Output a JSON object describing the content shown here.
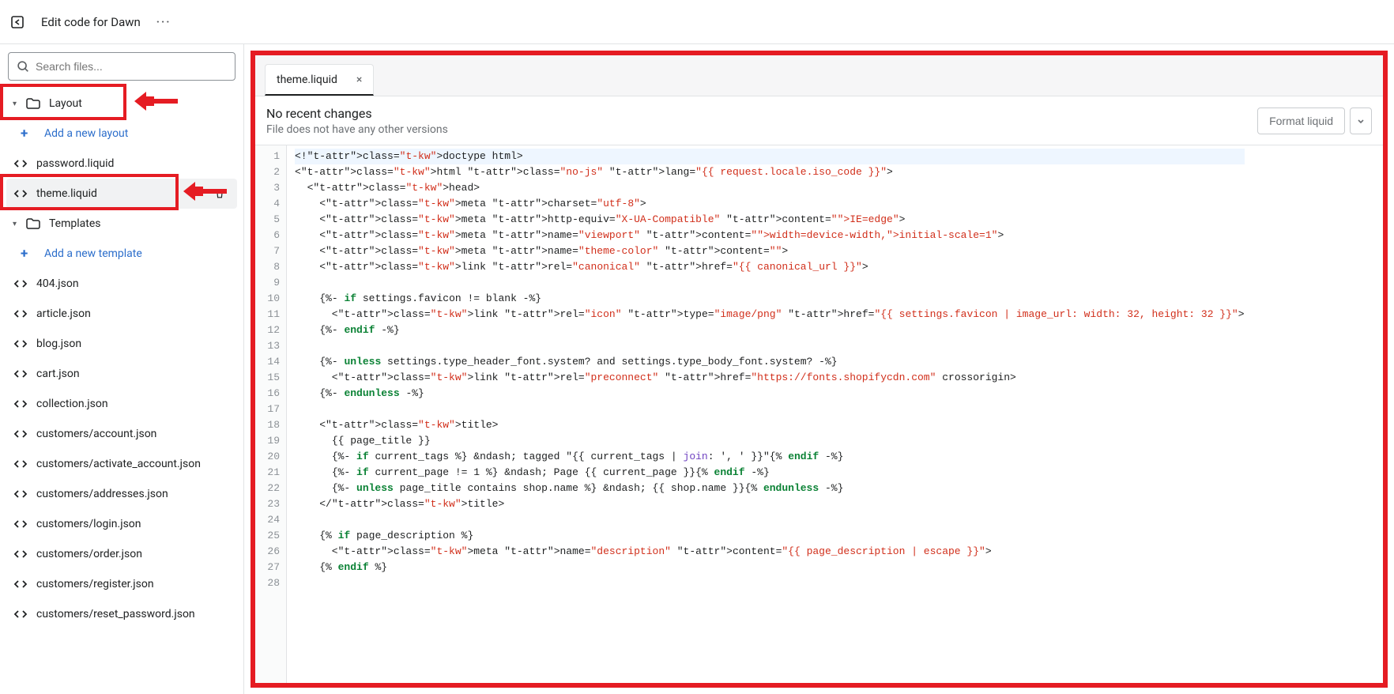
{
  "topbar": {
    "title": "Edit code for Dawn"
  },
  "sidebar": {
    "search_placeholder": "Search files...",
    "folders": {
      "layout_label": "Layout",
      "templates_label": "Templates"
    },
    "add_layout_label": "Add a new layout",
    "add_template_label": "Add a new template",
    "layout_files": [
      "password.liquid",
      "theme.liquid"
    ],
    "template_files": [
      "404.json",
      "article.json",
      "blog.json",
      "cart.json",
      "collection.json",
      "customers/account.json",
      "customers/activate_account.json",
      "customers/addresses.json",
      "customers/login.json",
      "customers/order.json",
      "customers/register.json",
      "customers/reset_password.json"
    ],
    "selected_file": "theme.liquid"
  },
  "editor": {
    "tab_label": "theme.liquid",
    "status_title": "No recent changes",
    "status_sub": "File does not have any other versions",
    "format_btn": "Format liquid",
    "line_count": 28
  },
  "code_raw_lines": [
    "<!doctype html>",
    "<html class=\"no-js\" lang=\"{{ request.locale.iso_code }}\">",
    "  <head>",
    "    <meta charset=\"utf-8\">",
    "    <meta http-equiv=\"X-UA-Compatible\" content=\"IE=edge\">",
    "    <meta name=\"viewport\" content=\"width=device-width,initial-scale=1\">",
    "    <meta name=\"theme-color\" content=\"\">",
    "    <link rel=\"canonical\" href=\"{{ canonical_url }}\">",
    "",
    "    {%- if settings.favicon != blank -%}",
    "      <link rel=\"icon\" type=\"image/png\" href=\"{{ settings.favicon | image_url: width: 32, height: 32 }}\">",
    "    {%- endif -%}",
    "",
    "    {%- unless settings.type_header_font.system? and settings.type_body_font.system? -%}",
    "      <link rel=\"preconnect\" href=\"https://fonts.shopifycdn.com\" crossorigin>",
    "    {%- endunless -%}",
    "",
    "    <title>",
    "      {{ page_title }}",
    "      {%- if current_tags %} &ndash; tagged \"{{ current_tags | join: ', ' }}\"{% endif -%}",
    "      {%- if current_page != 1 %} &ndash; Page {{ current_page }}{% endif -%}",
    "      {%- unless page_title contains shop.name %} &ndash; {{ shop.name }}{% endunless -%}",
    "    </title>",
    "",
    "    {% if page_description %}",
    "      <meta name=\"description\" content=\"{{ page_description | escape }}\">",
    "    {% endif %}",
    ""
  ]
}
